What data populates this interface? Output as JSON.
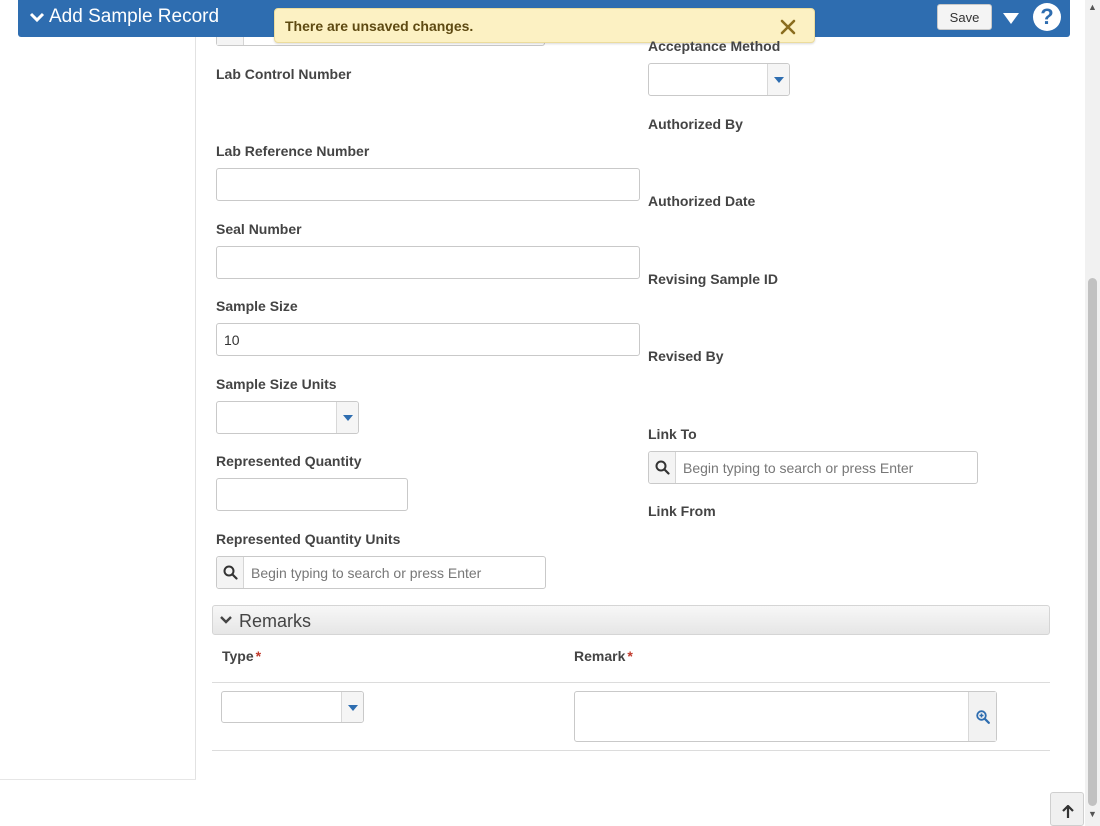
{
  "header": {
    "title": "Add Sample Record",
    "save_label": "Save",
    "help_label": "?"
  },
  "toast": {
    "message": "There are unsaved changes."
  },
  "form": {
    "left": {
      "lab_control_number_label": "Lab Control Number",
      "lab_reference_number_label": "Lab Reference Number",
      "lab_reference_number_value": "",
      "seal_number_label": "Seal Number",
      "seal_number_value": "",
      "sample_size_label": "Sample Size",
      "sample_size_value": "10",
      "sample_size_units_label": "Sample Size Units",
      "represented_quantity_label": "Represented Quantity",
      "represented_quantity_value": "",
      "represented_quantity_units_label": "Represented Quantity Units",
      "represented_quantity_units_placeholder": "Begin typing to search or press Enter"
    },
    "right": {
      "acceptance_method_label": "Acceptance Method",
      "authorized_by_label": "Authorized By",
      "authorized_date_label": "Authorized Date",
      "revising_sample_id_label": "Revising Sample ID",
      "revised_by_label": "Revised By",
      "link_to_label": "Link To",
      "link_to_placeholder": "Begin typing to search or press Enter",
      "link_from_label": "Link From"
    }
  },
  "remarks": {
    "section_title": "Remarks",
    "type_header": "Type",
    "remark_header": "Remark",
    "required_marker": "*"
  },
  "colors": {
    "header_bg": "#2e6db0",
    "toast_bg": "#fcf1c3",
    "required": "#c0392b"
  }
}
